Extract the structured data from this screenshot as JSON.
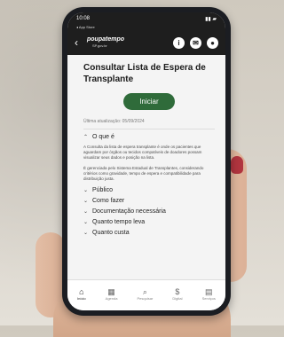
{
  "status": {
    "time": "10:08",
    "back_app": "◂ App Store"
  },
  "header": {
    "brand": "poupatempo",
    "brand_sub": "SP.gov.br",
    "icons": [
      "info-icon",
      "mail-icon",
      "user-icon"
    ]
  },
  "page": {
    "title": "Consultar Lista de Espera de Transplante",
    "start_label": "Iniciar",
    "updated": "Última atualização: 05/09/2024"
  },
  "sections": {
    "open": {
      "label": "O que é",
      "p1": "A Consulta da lista de espera transplante é onde os pacientes que aguardam por órgãos ou tecidos compatíveis de doadores possam visualizar seus dados e posição na lista.",
      "p2": "É gerenciada pelo Sistema Estadual de Transplantes, considerando critérios como gravidade, tempo de espera e compatibilidade para distribuição justa."
    },
    "closed": [
      "Público",
      "Como fazer",
      "Documentação necessária",
      "Quanto tempo leva",
      "Quanto custa"
    ]
  },
  "tabbar": [
    {
      "label": "Início",
      "icon": "home-icon"
    },
    {
      "label": "Agenda",
      "icon": "calendar-icon"
    },
    {
      "label": "Pesquisar",
      "icon": "search-icon"
    },
    {
      "label": "Digital",
      "icon": "dollar-icon"
    },
    {
      "label": "Serviços",
      "icon": "grid-icon"
    }
  ]
}
